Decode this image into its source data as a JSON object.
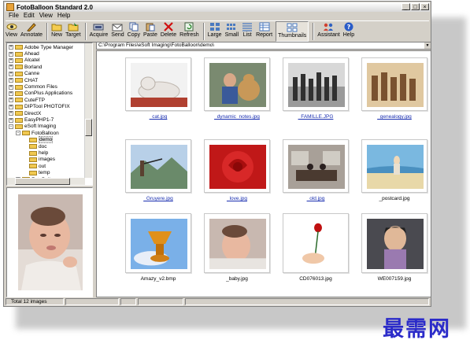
{
  "window": {
    "title": "FotoBalloon Standard 2.0"
  },
  "menu": [
    "File",
    "Edit",
    "View",
    "Help"
  ],
  "toolbar": [
    {
      "label": "View",
      "icon": "eye-icon"
    },
    {
      "label": "Annotate",
      "icon": "pencil-icon"
    },
    {
      "label": "New",
      "icon": "folder-new-icon"
    },
    {
      "label": "Target",
      "icon": "folder-target-icon"
    },
    {
      "label": "Acquire",
      "icon": "scanner-icon"
    },
    {
      "label": "Send",
      "icon": "envelope-icon"
    },
    {
      "label": "Copy",
      "icon": "copy-icon"
    },
    {
      "label": "Paste",
      "icon": "paste-icon"
    },
    {
      "label": "Delete",
      "icon": "delete-x-icon"
    },
    {
      "label": "Refresh",
      "icon": "refresh-icon"
    },
    {
      "label": "Large",
      "icon": "large-icons-icon"
    },
    {
      "label": "Small",
      "icon": "small-icons-icon"
    },
    {
      "label": "List",
      "icon": "list-icon"
    },
    {
      "label": "Report",
      "icon": "report-icon"
    },
    {
      "label": "Thumbnails",
      "icon": "thumbnails-icon"
    },
    {
      "label": "Assistant",
      "icon": "people-icon"
    },
    {
      "label": "Help",
      "icon": "help-icon"
    }
  ],
  "tree": [
    {
      "label": "Adobe Type Manager",
      "expander": "+"
    },
    {
      "label": "Ahead",
      "expander": "+"
    },
    {
      "label": "Alcatel",
      "expander": "+"
    },
    {
      "label": "Borland",
      "expander": "+"
    },
    {
      "label": "Canne",
      "expander": "+"
    },
    {
      "label": "CHAT",
      "expander": "+"
    },
    {
      "label": "Common Files",
      "expander": "+"
    },
    {
      "label": "ConPlus Applications",
      "expander": "+"
    },
    {
      "label": "CuteFTP",
      "expander": "+"
    },
    {
      "label": "DIPTool PHOTOFIX",
      "expander": "+"
    },
    {
      "label": "DirectX",
      "expander": "+"
    },
    {
      "label": "EasyPHP1-7",
      "expander": "+"
    },
    {
      "label": "eSoft Imaging",
      "expander": "-"
    },
    {
      "label": "FotoBalloon",
      "expander": "-"
    },
    {
      "label": "demo",
      "expander": ""
    },
    {
      "label": "doc",
      "expander": ""
    },
    {
      "label": "help",
      "expander": ""
    },
    {
      "label": "images",
      "expander": ""
    },
    {
      "label": "out",
      "expander": ""
    },
    {
      "label": "temp",
      "expander": ""
    },
    {
      "label": "FotoBalloo",
      "expander": "+"
    }
  ],
  "address": "C:\\Program Files\\eSoft Imaging\\FotoBalloon\\demo\\",
  "thumbnails": [
    {
      "caption": "_cat.jpg",
      "linked": true
    },
    {
      "caption": "_dynamic_notes.jpg",
      "linked": true
    },
    {
      "caption": "_FAMILLE.JPG",
      "linked": true
    },
    {
      "caption": "_genealogy.jpg",
      "linked": true
    },
    {
      "caption": "_Gruyere.jpg",
      "linked": true
    },
    {
      "caption": "_love.jpg",
      "linked": true
    },
    {
      "caption": "_old.jpg",
      "linked": true
    },
    {
      "caption": "_postcard.jpg",
      "linked": false
    },
    {
      "caption": "Amazy_v2.bmp",
      "linked": false
    },
    {
      "caption": "_baby.jpg",
      "linked": false
    },
    {
      "caption": "CD076013.jpg",
      "linked": false
    },
    {
      "caption": "WE007159.jpg",
      "linked": false
    }
  ],
  "status": {
    "count": "Total 12 images"
  },
  "watermark": "最需网"
}
